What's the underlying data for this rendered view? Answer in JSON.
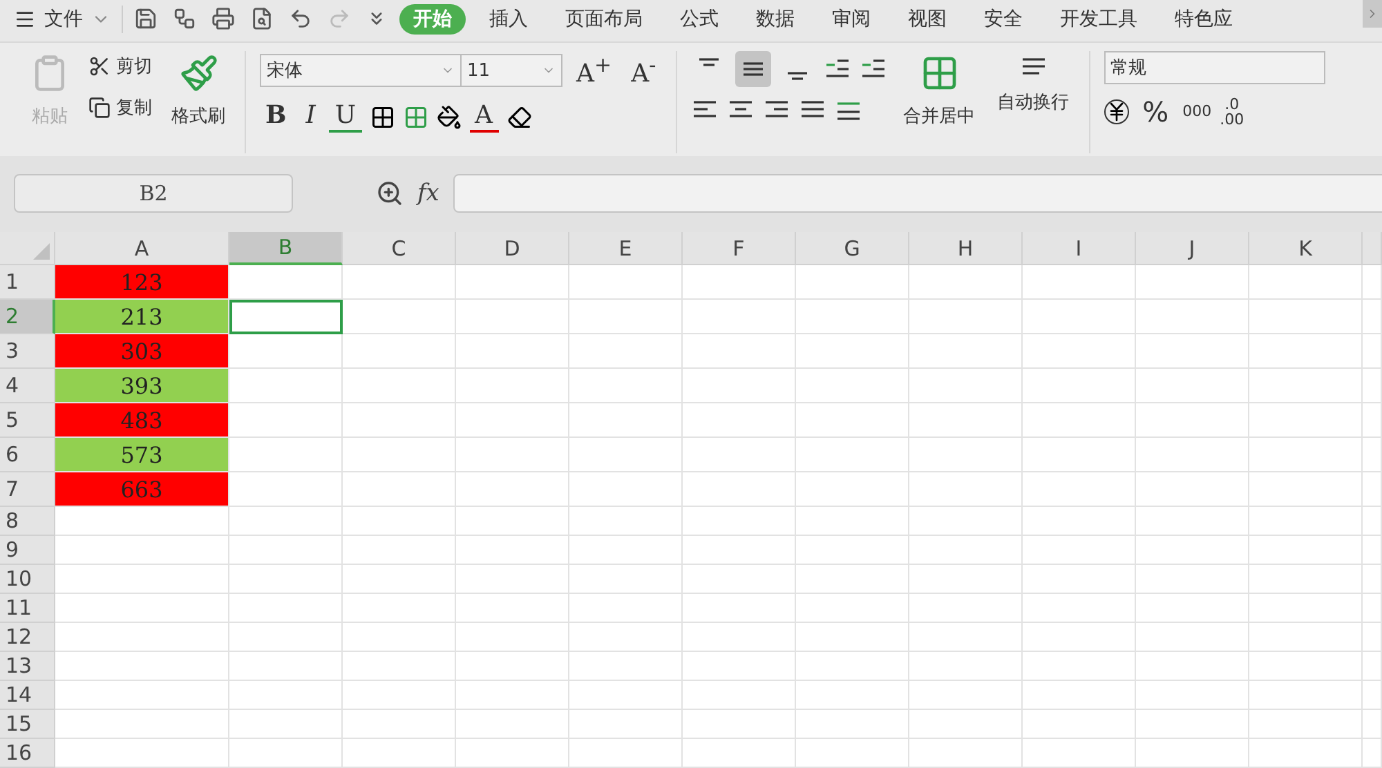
{
  "menu": {
    "label": "文件"
  },
  "tabs": [
    {
      "label": "开始",
      "selected": true
    },
    {
      "label": "插入",
      "selected": false
    },
    {
      "label": "页面布局",
      "selected": false
    },
    {
      "label": "公式",
      "selected": false
    },
    {
      "label": "数据",
      "selected": false
    },
    {
      "label": "审阅",
      "selected": false
    },
    {
      "label": "视图",
      "selected": false
    },
    {
      "label": "安全",
      "selected": false
    },
    {
      "label": "开发工具",
      "selected": false
    },
    {
      "label": "特色应",
      "selected": false
    }
  ],
  "clipboard": {
    "paste": {
      "label": "粘贴",
      "disabled": true
    },
    "cut": "剪切",
    "copy": "复制",
    "format_painter": "格式刷"
  },
  "font": {
    "name": "宋体",
    "size": "11",
    "grow": "A",
    "grow_mark": "+",
    "shrink": "A",
    "shrink_mark": "-",
    "bold": "B",
    "italic": "I",
    "underline": "U",
    "font_color": "A"
  },
  "alignment": {
    "vertical": [
      {
        "kind": "top",
        "selected": false
      },
      {
        "kind": "middle",
        "selected": true
      },
      {
        "kind": "bottom",
        "selected": false
      }
    ],
    "merge": "合并居中",
    "wrap": "自动换行"
  },
  "number": {
    "format": "常规",
    "percent": "%",
    "thousands": "000",
    "decimal": {
      "top": ".0",
      "bottom": ".00"
    }
  },
  "formula_bar": {
    "name_box": "B2",
    "fx": "fx"
  },
  "sheet": {
    "columns": [
      {
        "label": "A",
        "selected": false
      },
      {
        "label": "B",
        "selected": true
      },
      {
        "label": "C",
        "selected": false
      },
      {
        "label": "D",
        "selected": false
      },
      {
        "label": "E",
        "selected": false
      },
      {
        "label": "F",
        "selected": false
      },
      {
        "label": "G",
        "selected": false
      },
      {
        "label": "H",
        "selected": false
      },
      {
        "label": "I",
        "selected": false
      },
      {
        "label": "J",
        "selected": false
      },
      {
        "label": "K",
        "selected": false
      }
    ],
    "rows": [
      {
        "label": "1",
        "selected": false,
        "a": {
          "value": "123",
          "color": "#ff0000"
        }
      },
      {
        "label": "2",
        "selected": true,
        "a": {
          "value": "213",
          "color": "#92d050"
        }
      },
      {
        "label": "3",
        "selected": false,
        "a": {
          "value": "303",
          "color": "#ff0000"
        }
      },
      {
        "label": "4",
        "selected": false,
        "a": {
          "value": "393",
          "color": "#92d050"
        }
      },
      {
        "label": "5",
        "selected": false,
        "a": {
          "value": "483",
          "color": "#ff0000"
        }
      },
      {
        "label": "6",
        "selected": false,
        "a": {
          "value": "573",
          "color": "#92d050"
        }
      },
      {
        "label": "7",
        "selected": false,
        "a": {
          "value": "663",
          "color": "#ff0000"
        }
      },
      {
        "label": "8",
        "selected": false
      },
      {
        "label": "9",
        "selected": false
      },
      {
        "label": "10",
        "selected": false
      },
      {
        "label": "11",
        "selected": false
      },
      {
        "label": "12",
        "selected": false
      },
      {
        "label": "13",
        "selected": false
      },
      {
        "label": "14",
        "selected": false
      },
      {
        "label": "15",
        "selected": false
      },
      {
        "label": "16",
        "selected": false
      }
    ]
  }
}
